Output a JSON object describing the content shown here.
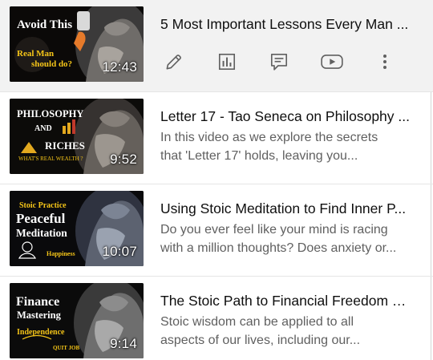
{
  "videos": [
    {
      "title": "5 Most Important Lessons Every Man ...",
      "duration": "12:43",
      "thumb_texts": [
        "Avoid This",
        "Real Man",
        "should do?"
      ],
      "actions": [
        {
          "icon": "pencil-icon",
          "name": "edit-button"
        },
        {
          "icon": "bar-chart-icon",
          "name": "analytics-button"
        },
        {
          "icon": "comment-icon",
          "name": "comments-button"
        },
        {
          "icon": "play-icon",
          "name": "view-on-youtube-button"
        },
        {
          "icon": "more-vert-icon",
          "name": "more-options-button"
        }
      ]
    },
    {
      "title": "Letter 17 - Tao Seneca on Philosophy ...",
      "desc_line1": "In this video as we explore the secrets",
      "desc_line2": "that 'Letter 17' holds, leaving you...",
      "duration": "9:52",
      "thumb_texts": [
        "PHILOSOPHY",
        "AND",
        "RICHES",
        "WHAT'S REAL WEALTH ?"
      ]
    },
    {
      "title": "Using Stoic Meditation to Find Inner P...",
      "desc_line1": "Do you ever feel like your mind is racing",
      "desc_line2": "with a million thoughts? Does anxiety or...",
      "duration": "10:07",
      "thumb_texts": [
        "Stoic Practice",
        "Peaceful",
        "Meditation",
        "Happiness"
      ]
    },
    {
      "title": "The Stoic Path to Financial Freedom R...",
      "desc_line1": "Stoic wisdom can be applied to all",
      "desc_line2": "aspects of our lives, including our...",
      "duration": "9:14",
      "thumb_texts": [
        "Finance",
        "Mastering",
        "Independence",
        "QUIT JOB"
      ]
    }
  ],
  "colors": {
    "selected_row_bg": "#f2f2f2",
    "title_text": "#0f0f0f",
    "desc_text": "#606060",
    "icon": "#606060",
    "thumb_yellow": "#f5c518"
  }
}
